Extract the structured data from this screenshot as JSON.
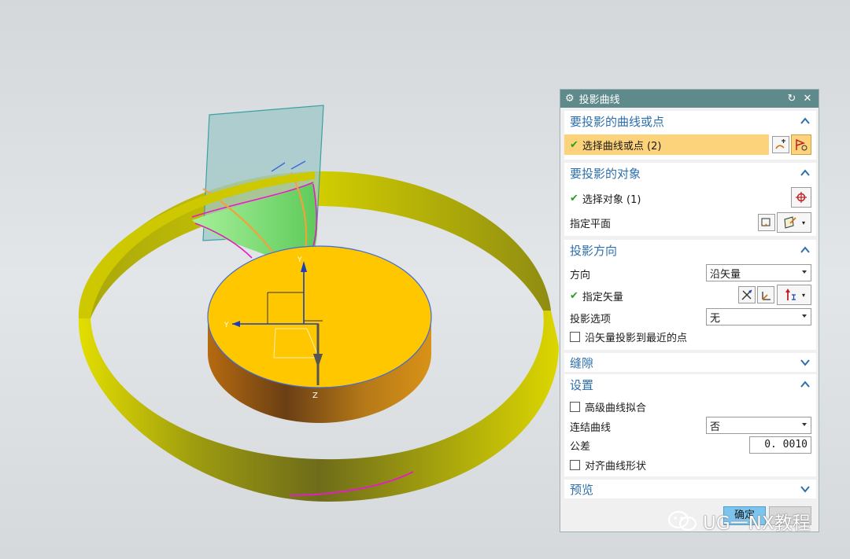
{
  "dialog": {
    "title": "投影曲线",
    "section_curves": {
      "title": "要投影的曲线或点",
      "select_label": "选择曲线或点 (2)"
    },
    "section_objects": {
      "title": "要投影的对象",
      "select_label": "选择对象 (1)",
      "plane_label": "指定平面"
    },
    "section_direction": {
      "title": "投影方向",
      "direction_label": "方向",
      "direction_value": "沿矢量",
      "vector_label": "指定矢量",
      "option_label": "投影选项",
      "option_value": "无",
      "nearest_label": "沿矢量投影到最近的点"
    },
    "section_gap": {
      "title": "缝隙"
    },
    "section_settings": {
      "title": "设置",
      "advanced_label": "高级曲线拟合",
      "join_label": "连结曲线",
      "join_value": "否",
      "tolerance_label": "公差",
      "tolerance_value": "0. 0010",
      "align_label": "对齐曲线形状"
    },
    "section_preview": {
      "title": "预览"
    },
    "ok_label": "确定"
  },
  "viewport": {
    "axis_y_label": "Y",
    "axis_y2_label": "Y",
    "axis_z_label": "Z"
  },
  "watermark": {
    "text": "UG一NX教程"
  },
  "colors": {
    "title_bar": "#5f8a8b",
    "section_title": "#2d6fab",
    "highlight": "#fcd37b",
    "disk_top": "#ffc700",
    "ring": "#c9c400",
    "green_surface": "#88e07a",
    "projected_curve": "#e020c0"
  }
}
